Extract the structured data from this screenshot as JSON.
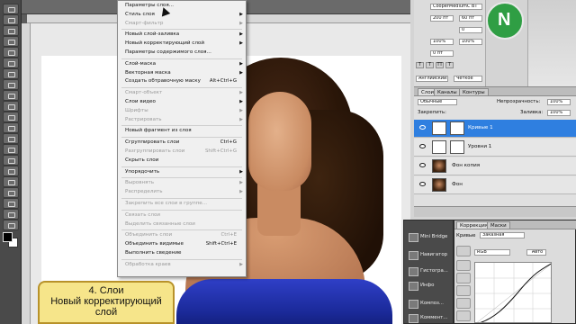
{
  "menu": {
    "items": [
      {
        "label": "Параметры слоя...",
        "disabled": false,
        "submenu": false,
        "shortcut": ""
      },
      {
        "label": "Стиль слоя",
        "disabled": false,
        "submenu": true,
        "shortcut": ""
      },
      {
        "label": "Смарт-фильтр",
        "disabled": true,
        "submenu": true,
        "shortcut": ""
      },
      {
        "label": "Новый слой-заливка",
        "disabled": false,
        "submenu": true,
        "shortcut": ""
      },
      {
        "label": "Новый корректирующий слой",
        "disabled": false,
        "submenu": true,
        "shortcut": ""
      },
      {
        "label": "Параметры содержимого слоя...",
        "disabled": false,
        "submenu": false,
        "shortcut": ""
      },
      {
        "label": "Слой-маска",
        "disabled": false,
        "submenu": true,
        "shortcut": ""
      },
      {
        "label": "Векторная маска",
        "disabled": false,
        "submenu": true,
        "shortcut": ""
      },
      {
        "label": "Создать обтравочную маску",
        "disabled": false,
        "submenu": false,
        "shortcut": "Alt+Ctrl+G"
      },
      {
        "label": "Смарт-объект",
        "disabled": true,
        "submenu": true,
        "shortcut": ""
      },
      {
        "label": "Слои видео",
        "disabled": false,
        "submenu": true,
        "shortcut": ""
      },
      {
        "label": "Шрифты",
        "disabled": true,
        "submenu": true,
        "shortcut": ""
      },
      {
        "label": "Растрировать",
        "disabled": true,
        "submenu": true,
        "shortcut": ""
      },
      {
        "label": "Новый фрагмент из слоя",
        "disabled": false,
        "submenu": false,
        "shortcut": ""
      },
      {
        "label": "Сгруппировать слои",
        "disabled": false,
        "submenu": false,
        "shortcut": "Ctrl+G"
      },
      {
        "label": "Разгруппировать слои",
        "disabled": true,
        "submenu": false,
        "shortcut": "Shift+Ctrl+G"
      },
      {
        "label": "Скрыть слои",
        "disabled": false,
        "submenu": false,
        "shortcut": ""
      },
      {
        "label": "Упорядочить",
        "disabled": false,
        "submenu": true,
        "shortcut": ""
      },
      {
        "label": "Выровнять",
        "disabled": true,
        "submenu": true,
        "shortcut": ""
      },
      {
        "label": "Распределить",
        "disabled": true,
        "submenu": true,
        "shortcut": ""
      },
      {
        "label": "Закрепить все слои в группе...",
        "disabled": true,
        "submenu": false,
        "shortcut": ""
      },
      {
        "label": "Связать слои",
        "disabled": true,
        "submenu": false,
        "shortcut": ""
      },
      {
        "label": "Выделить связанные слои",
        "disabled": true,
        "submenu": false,
        "shortcut": ""
      },
      {
        "label": "Объединить слои",
        "disabled": true,
        "submenu": false,
        "shortcut": "Ctrl+E"
      },
      {
        "label": "Объединить видимые",
        "disabled": false,
        "submenu": false,
        "shortcut": "Shift+Ctrl+E"
      },
      {
        "label": "Выполнить сведение",
        "disabled": false,
        "submenu": false,
        "shortcut": ""
      },
      {
        "label": "Обработка краев",
        "disabled": true,
        "submenu": true,
        "shortcut": ""
      }
    ]
  },
  "caption": {
    "title": "4. Слои",
    "subtitle": "Новый корректирующий слой"
  },
  "character": {
    "font": "CooperMediumC BT",
    "style": "Medium",
    "size": "200 пт",
    "leading": "60 пт",
    "tracking": "0",
    "vscale": "100%",
    "hscale": "100%",
    "baseline": "0 пт",
    "language": "Английский: США",
    "aa": "Четкое"
  },
  "layers": {
    "tabs": [
      "Слои",
      "Каналы",
      "Контуры"
    ],
    "blend_mode": "Обычные",
    "opacity_label": "Непрозрачность:",
    "opacity": "100%",
    "lock_label": "Закрепить:",
    "fill_label": "Заливка:",
    "fill": "100%",
    "items": [
      {
        "name": "Кривые 1"
      },
      {
        "name": "Уровни 1"
      },
      {
        "name": "Фон копия"
      },
      {
        "name": "Фон"
      }
    ]
  },
  "side_panel": {
    "items": [
      "Mini Bridge",
      "Навигатор",
      "Гистогра...",
      "Инфо",
      "Композ...",
      "Коммент..."
    ]
  },
  "adjustments": {
    "tabs": [
      "Коррекция",
      "Маски"
    ],
    "label": "Кривые",
    "preset": "Заказная",
    "channel": "RGB",
    "auto": "Авто"
  }
}
